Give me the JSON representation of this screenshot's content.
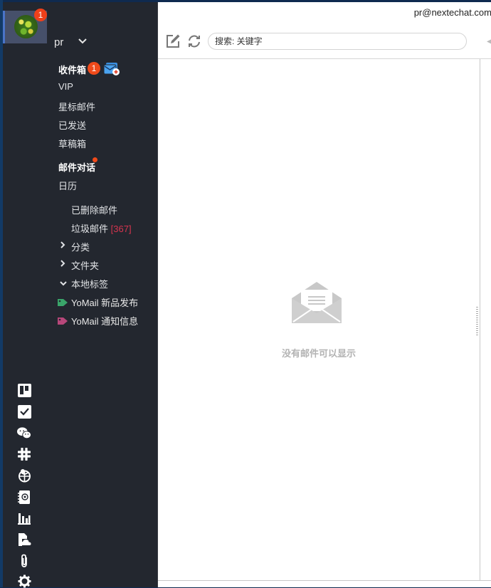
{
  "account": {
    "name": "pr",
    "email": "pr@nextechat.com",
    "unread_badge": "1"
  },
  "mailboxes": [
    {
      "label": "收件箱",
      "badge": "1"
    },
    {
      "label": "VIP"
    },
    {
      "label": "星标邮件"
    },
    {
      "label": "已发送"
    },
    {
      "label": "草稿箱"
    }
  ],
  "conversations": {
    "label": "邮件对话",
    "has_new": true
  },
  "calendar": {
    "label": "日历"
  },
  "sub_folders": [
    {
      "label": "已删除邮件"
    },
    {
      "label": "垃圾邮件",
      "count": "[367]"
    }
  ],
  "groups": [
    {
      "label": "分类",
      "expanded": false
    },
    {
      "label": "文件夹",
      "expanded": false
    },
    {
      "label": "本地标签",
      "expanded": true
    }
  ],
  "tags": [
    {
      "label": "YoMail 新品发布",
      "color": "#3aa56a"
    },
    {
      "label": "YoMail 通知信息",
      "color": "#b7477a"
    }
  ],
  "tools": [
    "board-icon",
    "task-check-icon",
    "wechat-icon",
    "slack-icon",
    "globe-icon",
    "address-book-icon",
    "stats-chart-icon",
    "cloud-file-icon",
    "attachment-icon",
    "settings-gear-icon"
  ],
  "toolbar": {
    "search_placeholder": "搜索: 关键字"
  },
  "empty_state": {
    "message": "没有邮件可以显示"
  },
  "colors": {
    "sidebar_bg": "#23272f",
    "badge": "#f04a1a",
    "spam_count": "#d6344f"
  }
}
